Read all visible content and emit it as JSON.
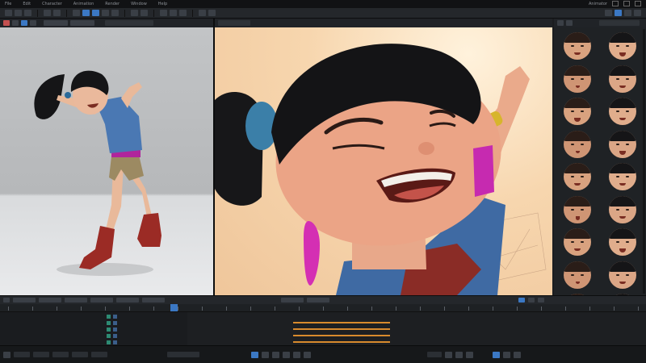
{
  "menubar": {
    "items": [
      "File",
      "Edit",
      "Character",
      "Animation",
      "Render",
      "Window",
      "Help"
    ],
    "right_label": "Animator"
  },
  "colors": {
    "accent": "#3b78c4",
    "keyframe": "#d88a2d",
    "track_text": "#c35050"
  },
  "icons": {
    "minimize": "minimize-icon",
    "maximize": "maximize-icon",
    "close": "close-icon",
    "play": "play-icon",
    "key": "keyframe-icon"
  },
  "viewports": [
    {
      "name": "full-body-view"
    },
    {
      "name": "face-closeup-view"
    }
  ],
  "gallery": {
    "expressions": [
      "neutral",
      "smile",
      "wide-eyes",
      "surprised",
      "angry",
      "sad",
      "worried",
      "pout",
      "open-mouth",
      "grin",
      "talking",
      "laughing",
      "shout",
      "whistle",
      "frown",
      "blink",
      "wink",
      "sleepy",
      "smirk",
      "neutral-2"
    ]
  },
  "timeline": {
    "playhead_frame": 0.145,
    "tracks": [
      {
        "name": "",
        "color": "red"
      },
      {
        "name": "",
        "color": "red"
      },
      {
        "name": "",
        "color": "white"
      },
      {
        "name": "",
        "color": "white"
      },
      {
        "name": "",
        "color": "white"
      }
    ]
  }
}
